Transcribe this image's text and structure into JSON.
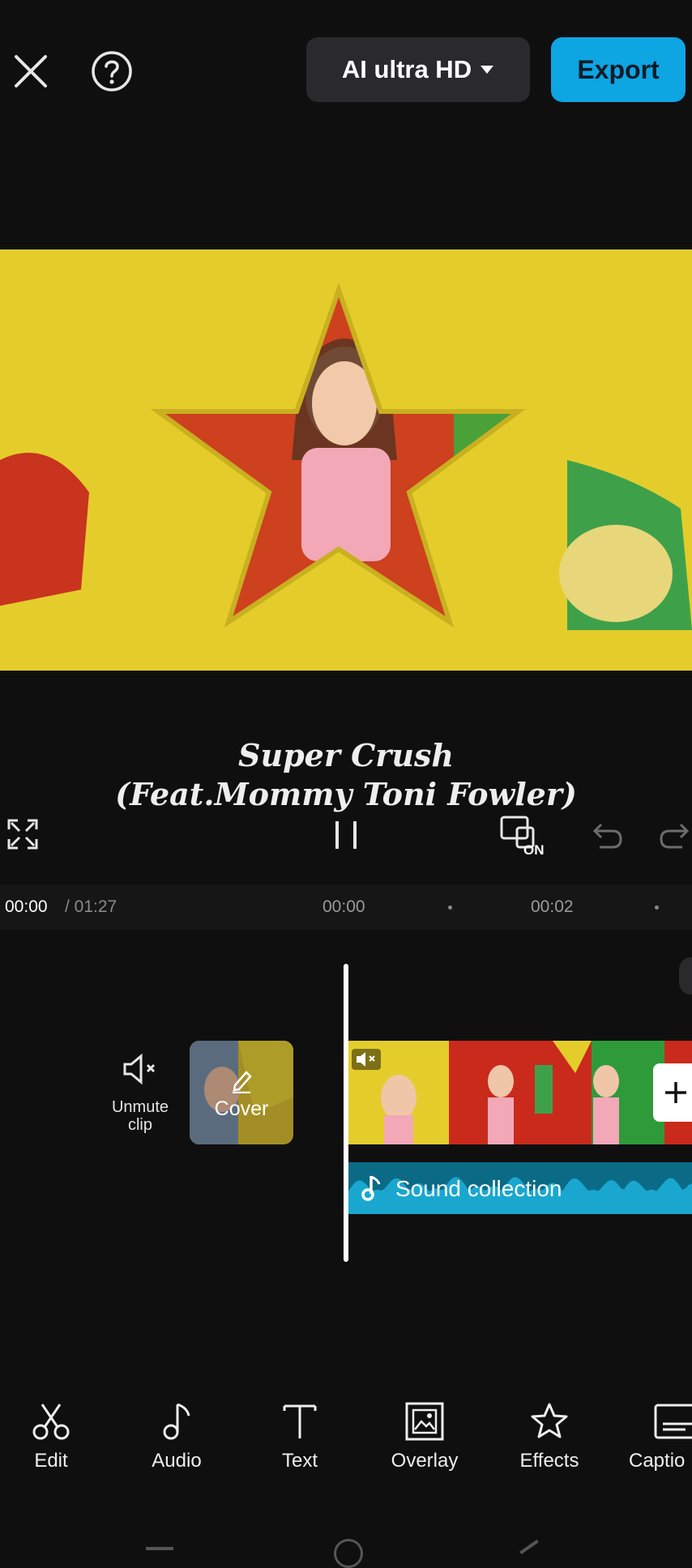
{
  "topbar": {
    "close_icon": "close-icon",
    "help_icon": "help-icon",
    "quality_label": "AI ultra HD",
    "export_label": "Export"
  },
  "preview": {
    "caption_line1": "Super Crush",
    "caption_line2": "(Feat.Mommy Toni Fowler)",
    "colors": {
      "yellow": "#e8cf2a",
      "red": "#cf2a1e"
    }
  },
  "controls": {
    "on_label": "ON"
  },
  "timeline": {
    "current_time": "00:00",
    "total_time": "/ 01:27",
    "ruler_ticks": [
      "00:00",
      "00:02"
    ],
    "unmute_label_line1": "Unmute",
    "unmute_label_line2": "clip",
    "cover_label": "Cover",
    "audio_track_label": "Sound collection"
  },
  "toolbar": {
    "items": [
      {
        "label": "Edit",
        "icon": "scissors-icon"
      },
      {
        "label": "Audio",
        "icon": "music-note-icon"
      },
      {
        "label": "Text",
        "icon": "text-icon"
      },
      {
        "label": "Overlay",
        "icon": "overlay-icon"
      },
      {
        "label": "Effects",
        "icon": "star-effects-icon"
      },
      {
        "label": "Captio",
        "icon": "captions-icon"
      }
    ]
  }
}
